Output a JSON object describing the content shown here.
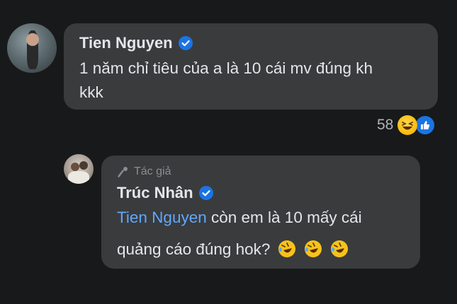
{
  "comment": {
    "author": "Tien Nguyen",
    "lines": [
      "1 năm chỉ tiêu của a là 10 cái mv đúng kh",
      "kkk"
    ],
    "reaction_count": "58",
    "reactions": [
      "laughing-emoji",
      "like-icon"
    ]
  },
  "reply": {
    "badge": "Tác giả",
    "author": "Trúc Nhân",
    "mention": "Tien Nguyen",
    "line1_rest": " còn em là 10 mấy cái",
    "line2": "quảng cáo đúng hok?",
    "emojis": [
      "rofl-emoji",
      "rofl-emoji",
      "rofl-emoji"
    ]
  },
  "colors": {
    "background": "#18191a",
    "bubble": "#3a3b3c",
    "verified": "#1b74e4",
    "mention": "#5ea8ff"
  }
}
